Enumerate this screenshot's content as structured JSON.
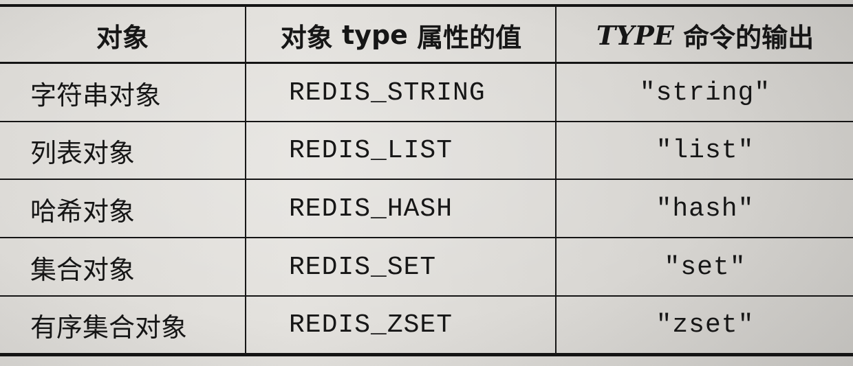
{
  "table": {
    "headers": {
      "object": "对象",
      "type_attr_prefix": "对象 ",
      "type_attr_word": "type",
      "type_attr_suffix": " 属性的值",
      "type_cmd_word": "TYPE",
      "type_cmd_suffix": " 命令的输出"
    },
    "rows": [
      {
        "object": "字符串对象",
        "type_value": "REDIS_STRING",
        "type_output": "\"string\""
      },
      {
        "object": "列表对象",
        "type_value": "REDIS_LIST",
        "type_output": "\"list\""
      },
      {
        "object": "哈希对象",
        "type_value": "REDIS_HASH",
        "type_output": "\"hash\""
      },
      {
        "object": "集合对象",
        "type_value": "REDIS_SET",
        "type_output": "\"set\""
      },
      {
        "object": "有序集合对象",
        "type_value": "REDIS_ZSET",
        "type_output": "\"zset\""
      }
    ]
  }
}
